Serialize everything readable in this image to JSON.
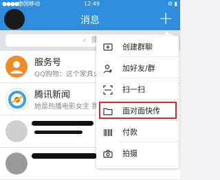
{
  "statusbar": {
    "signal": "●●●●○",
    "carrier": "中国移动",
    "time": "12:49",
    "right": "⚙ ▮"
  },
  "navbar": {
    "title": "消息",
    "plus": "+"
  },
  "search": {
    "placeholder": "搜"
  },
  "messages": [
    {
      "name": "服务号",
      "preview": "QQ购物：这个家具火了",
      "avatar_color": "#f28c28"
    },
    {
      "name": "腾讯新闻",
      "preview": "她是热播电影女主 我最",
      "avatar_color": "#3aa0e6"
    },
    {
      "name": "",
      "preview": "",
      "avatar_color": "#cfcfcf"
    },
    {
      "name": "",
      "preview": "",
      "avatar_color": "#9a9a9a"
    }
  ],
  "menu": {
    "items": [
      {
        "label": "创建群聊",
        "icon": "group-chat-icon"
      },
      {
        "label": "加好友/群",
        "icon": "add-friend-icon"
      },
      {
        "label": "扫一扫",
        "icon": "scan-icon"
      },
      {
        "label": "面对面快传",
        "icon": "folder-icon"
      },
      {
        "label": "付款",
        "icon": "barcode-icon"
      },
      {
        "label": "拍摄",
        "icon": "camera-icon"
      }
    ],
    "highlight_color": "#e02424"
  }
}
